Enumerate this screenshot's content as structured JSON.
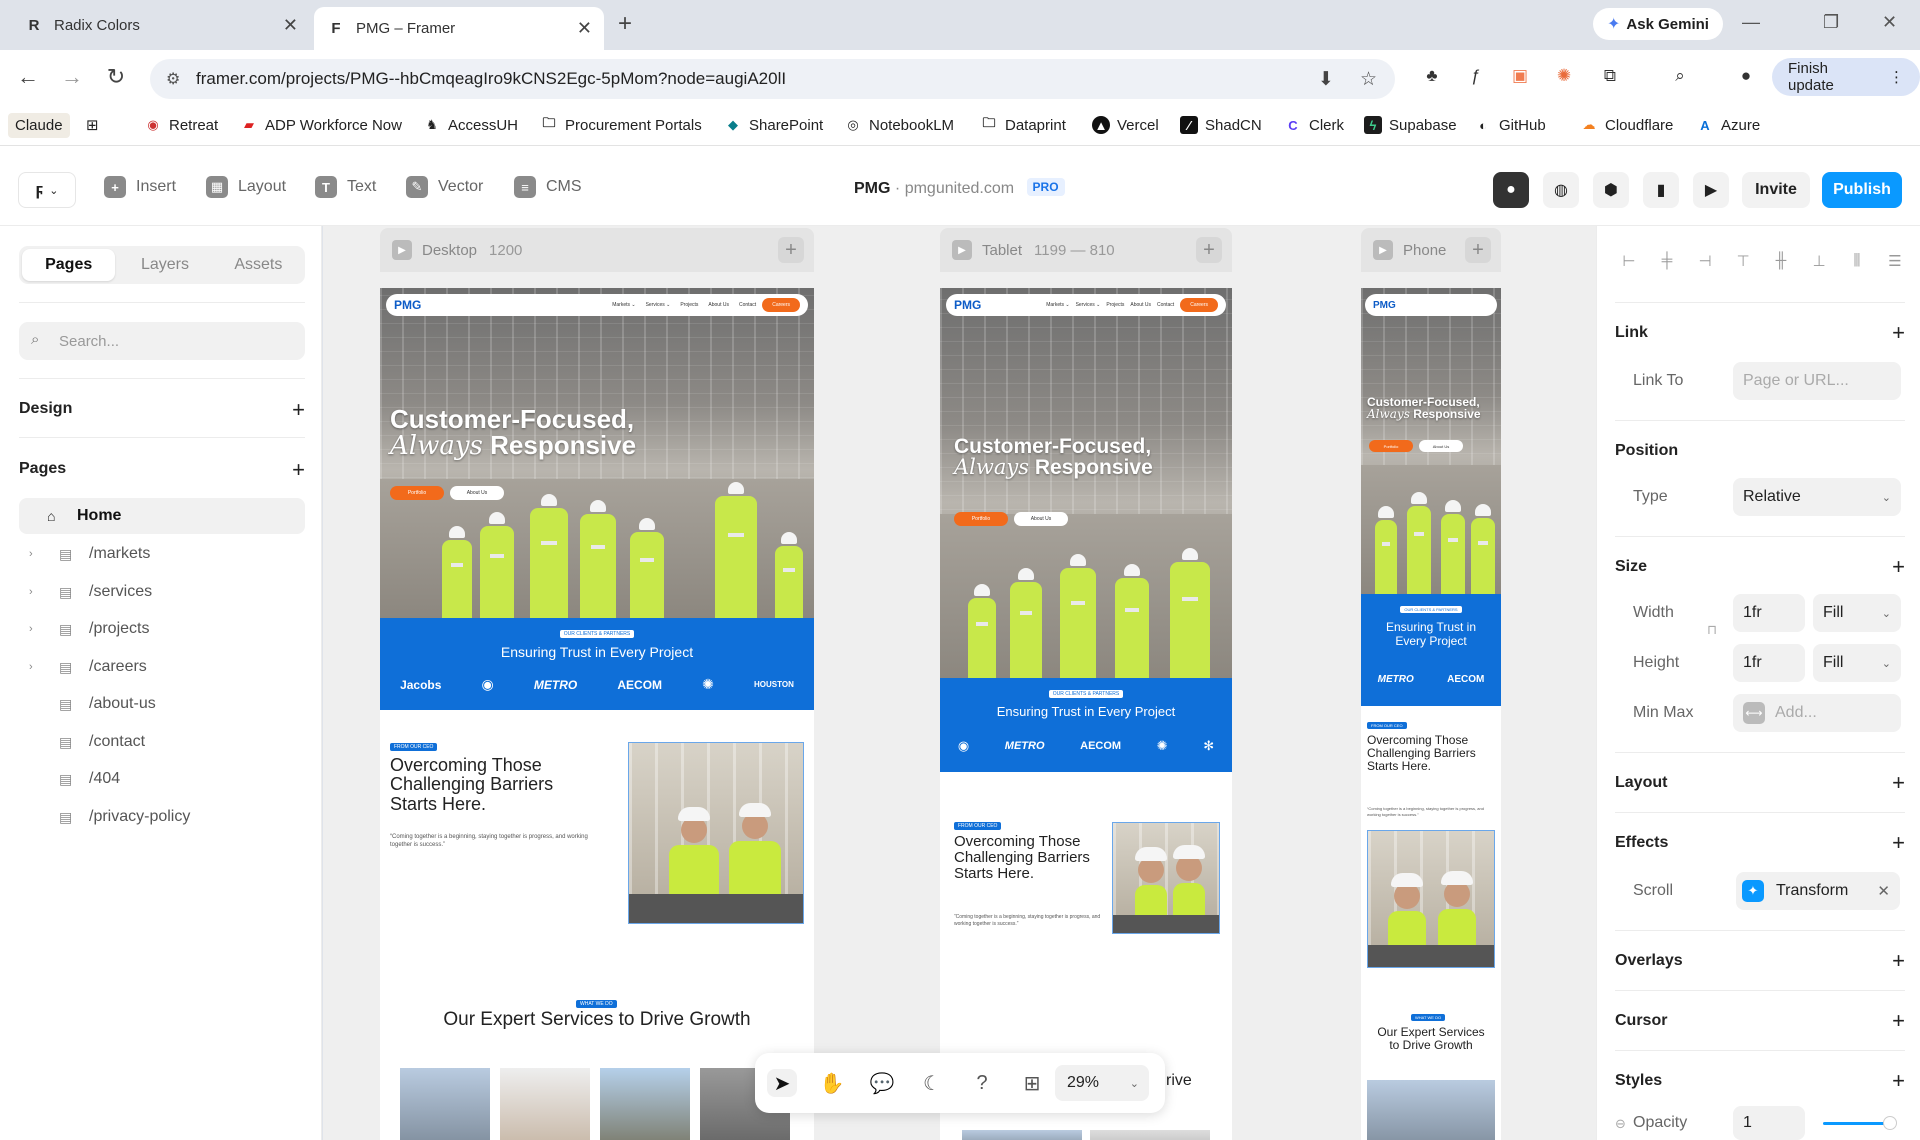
{
  "browser": {
    "tabs": [
      {
        "title": "Radix Colors",
        "favicon": "R"
      },
      {
        "title": "PMG – Framer",
        "favicon": "F"
      }
    ],
    "gemini_label": "Ask Gemini",
    "url": "framer.com/projects/PMG--hbCmqeagIro9kCNS2Egc-5pMom?node=augiA20lI",
    "finish_update_label": "Finish update",
    "bookmarks": [
      {
        "label": "Claude"
      },
      {
        "label": "Retreat"
      },
      {
        "label": "ADP Workforce Now"
      },
      {
        "label": "AccessUH"
      },
      {
        "label": "Procurement Portals"
      },
      {
        "label": "SharePoint"
      },
      {
        "label": "NotebookLM"
      },
      {
        "label": "Dataprint"
      },
      {
        "label": "Vercel"
      },
      {
        "label": "ShadCN"
      },
      {
        "label": "Clerk"
      },
      {
        "label": "Supabase"
      },
      {
        "label": "GitHub"
      },
      {
        "label": "Cloudflare"
      },
      {
        "label": "Azure"
      }
    ]
  },
  "framer": {
    "tools": [
      "Insert",
      "Layout",
      "Text",
      "Vector",
      "CMS"
    ],
    "project_name": "PMG",
    "project_domain": "pmgunited.com",
    "plan_badge": "PRO",
    "invite_label": "Invite",
    "publish_label": "Publish",
    "colors": {
      "publish": "#0a99ff",
      "brand_blue": "#0f6fd8",
      "brand_orange": "#f26a1b"
    }
  },
  "left_panel": {
    "tabs": [
      "Pages",
      "Layers",
      "Assets"
    ],
    "search_placeholder": "Search...",
    "design_label": "Design",
    "pages_label": "Pages",
    "pages": [
      {
        "name": "Home",
        "selected": true,
        "expandable": false
      },
      {
        "name": "/markets",
        "expandable": true
      },
      {
        "name": "/services",
        "expandable": true
      },
      {
        "name": "/projects",
        "expandable": true
      },
      {
        "name": "/careers",
        "expandable": true
      },
      {
        "name": "/about-us",
        "expandable": false
      },
      {
        "name": "/contact",
        "expandable": false
      },
      {
        "name": "/404",
        "expandable": false
      },
      {
        "name": "/privacy-policy",
        "expandable": false
      }
    ]
  },
  "canvas": {
    "breakpoints": [
      {
        "name": "Desktop",
        "dims": "1200"
      },
      {
        "name": "Tablet",
        "dims": "1199 — 810"
      },
      {
        "name": "Phone",
        "dims": ""
      }
    ],
    "site": {
      "logo": "PMG",
      "nav_links": [
        "Markets ⌄",
        "Services ⌄",
        "Projects",
        "About Us",
        "Contact"
      ],
      "nav_cta": "Careers",
      "headline_1": "Customer-Focused,",
      "headline_script": "Always",
      "headline_2": "Responsive",
      "btn_primary": "Portfolio",
      "btn_secondary": "About Us",
      "trust_tag": "OUR CLIENTS & PARTNERS",
      "trust_title": "Ensuring Trust in Every Project",
      "partner_logos": [
        "Jacobs",
        "METRO",
        "AECOM",
        "HOUSTON"
      ],
      "section_tag": "FROM OUR CEO",
      "section_title": "Overcoming Those Challenging Barriers Starts Here.",
      "section_quote": "“Coming together is a beginning, staying together is progress, and working together is success.”",
      "services_tag": "WHAT WE DO",
      "services_title": "Our Expert Services to Drive Growth",
      "services_fragment": "rive"
    },
    "zoom": "29%"
  },
  "right_panel": {
    "link": {
      "label": "Link",
      "link_to_label": "Link To",
      "placeholder": "Page or URL..."
    },
    "position": {
      "label": "Position",
      "type_label": "Type",
      "type_value": "Relative"
    },
    "size": {
      "label": "Size",
      "width_label": "Width",
      "width_value": "1fr",
      "width_mode": "Fill",
      "height_label": "Height",
      "height_value": "1fr",
      "height_mode": "Fill",
      "minmax_label": "Min Max",
      "minmax_placeholder": "Add..."
    },
    "layout_label": "Layout",
    "effects": {
      "label": "Effects",
      "scroll_label": "Scroll",
      "scroll_value": "Transform"
    },
    "overlays_label": "Overlays",
    "cursor_label": "Cursor",
    "styles": {
      "label": "Styles",
      "opacity_label": "Opacity",
      "opacity_value": "1"
    }
  }
}
